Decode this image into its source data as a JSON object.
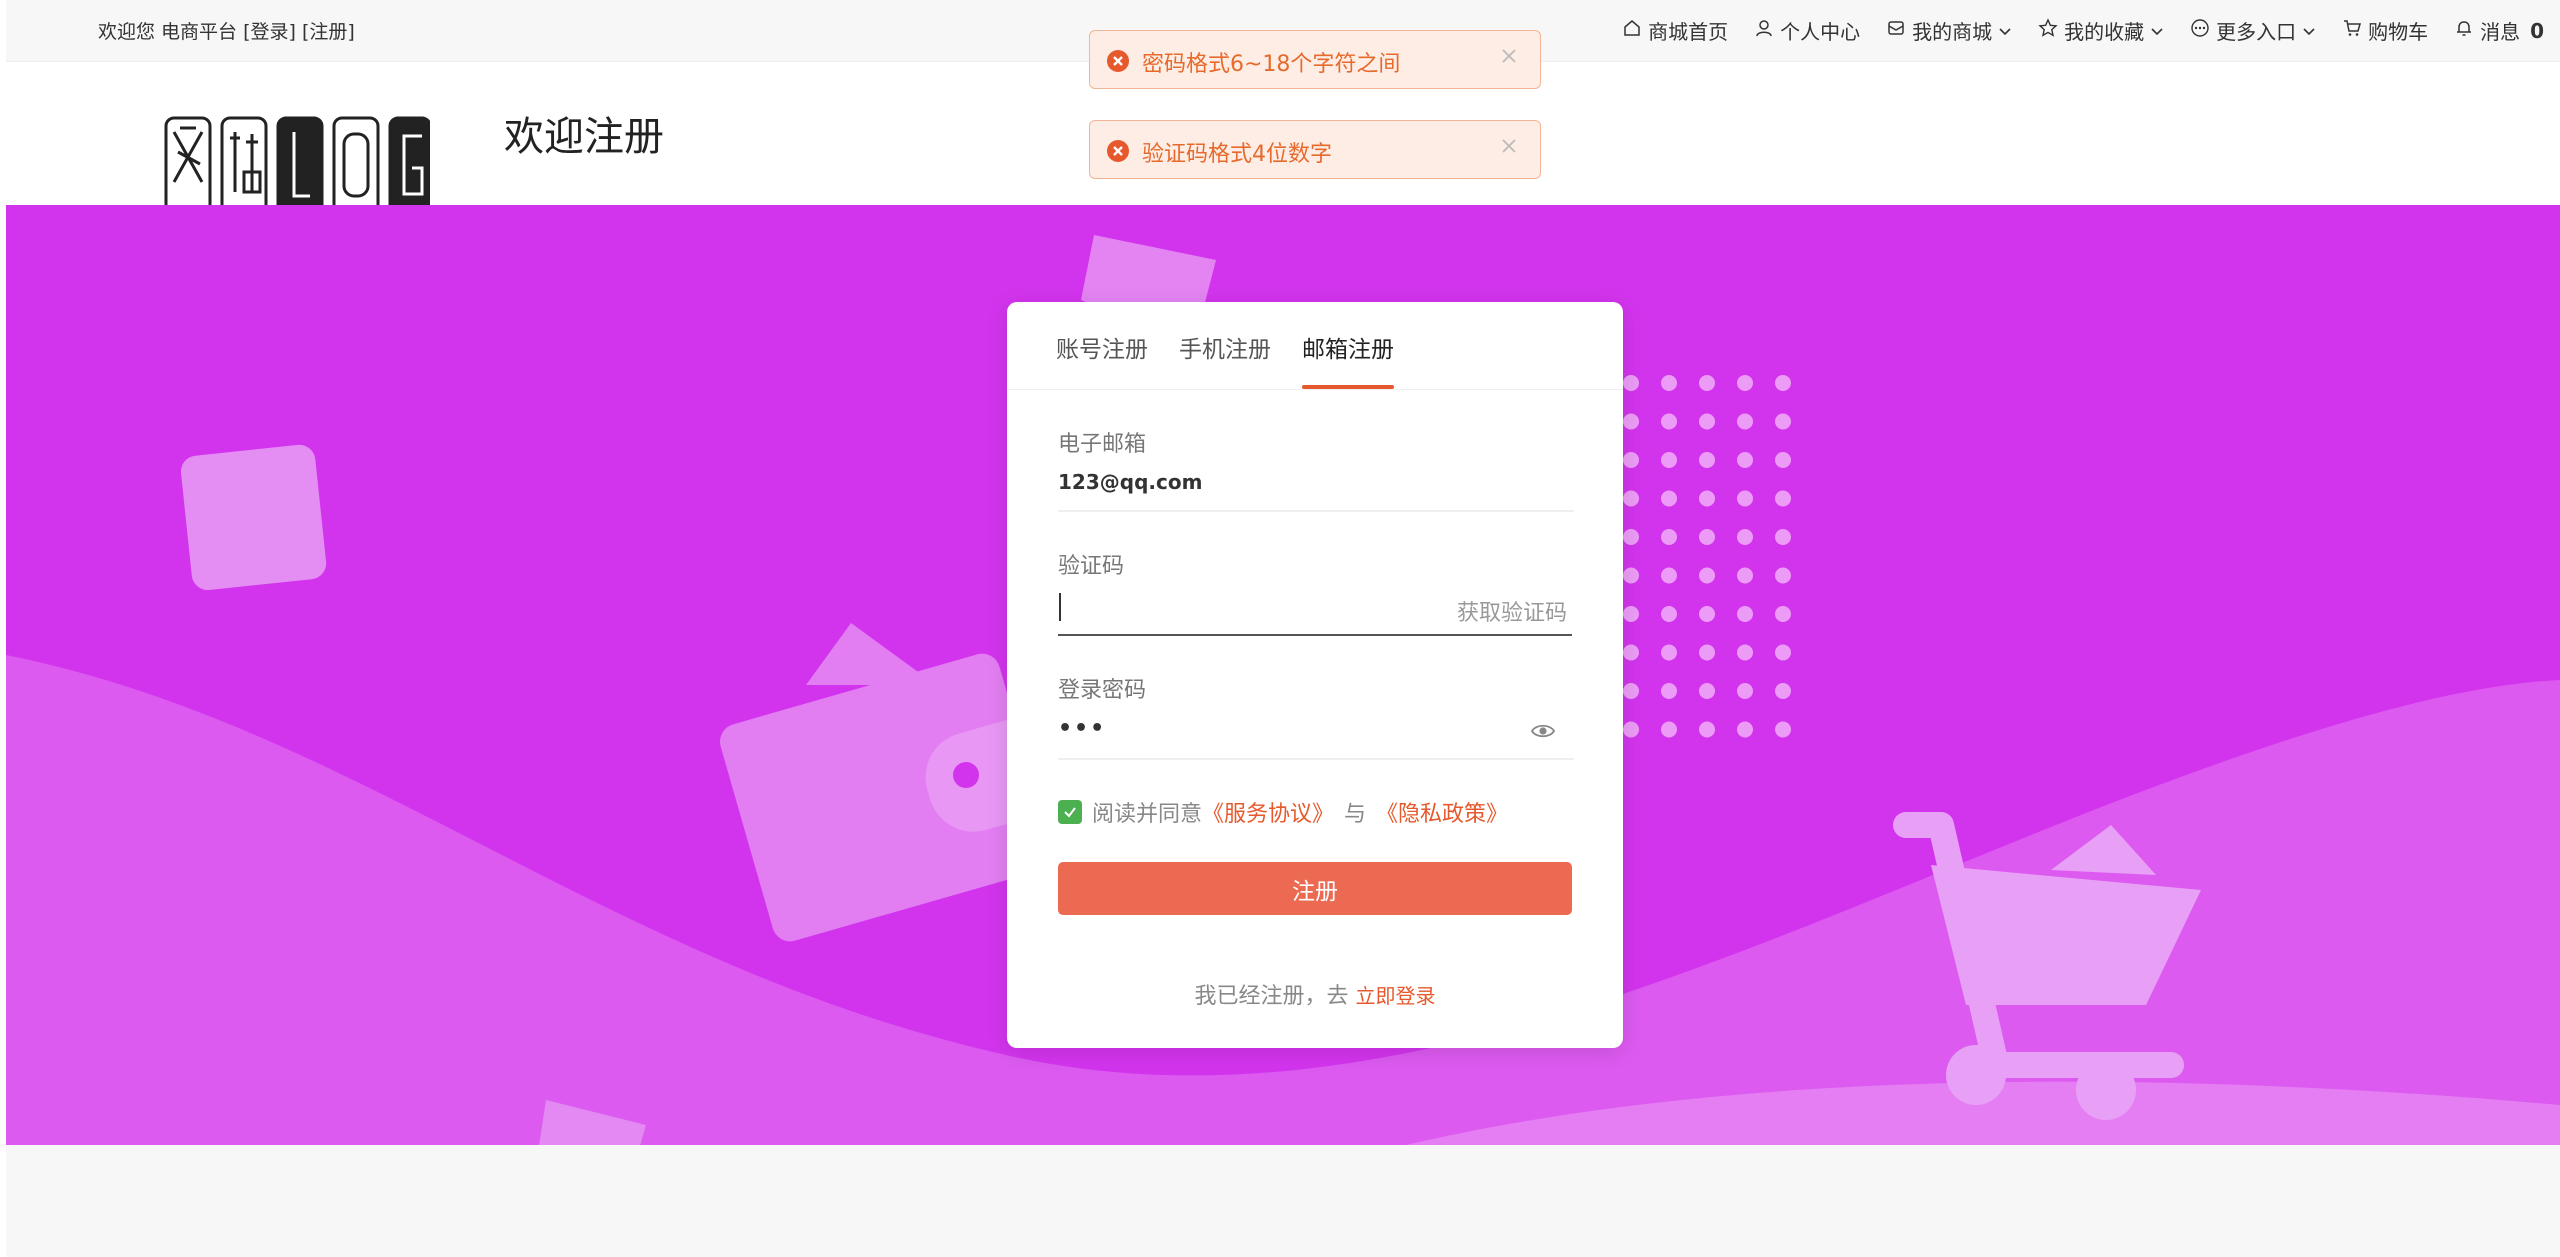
{
  "topbar": {
    "welcome": "欢迎您 电商平台",
    "login_link": "[登录]",
    "register_link": "[注册]",
    "nav": [
      {
        "label": "商城首页",
        "icon": "home-icon"
      },
      {
        "label": "个人中心",
        "icon": "user-icon"
      },
      {
        "label": "我的商城",
        "icon": "mall-icon",
        "dropdown": true
      },
      {
        "label": "我的收藏",
        "icon": "star-icon",
        "dropdown": true
      },
      {
        "label": "更多入口",
        "icon": "more-icon",
        "dropdown": true
      },
      {
        "label": "购物车",
        "icon": "cart-icon"
      },
      {
        "label": "消息",
        "icon": "bell-icon",
        "count": "0"
      }
    ]
  },
  "header": {
    "title": "欢迎注册",
    "logo_text": "网站LOG"
  },
  "toasts": [
    {
      "message": "密码格式6~18个字符之间",
      "type": "error"
    },
    {
      "message": "验证码格式4位数字",
      "type": "error"
    }
  ],
  "form": {
    "tabs": [
      {
        "label": "账号注册",
        "active": false
      },
      {
        "label": "手机注册",
        "active": false
      },
      {
        "label": "邮箱注册",
        "active": true
      }
    ],
    "email_label": "电子邮箱",
    "email_value": "123@qq.com",
    "code_label": "验证码",
    "code_value": "",
    "get_code": "获取验证码",
    "password_label": "登录密码",
    "password_mask": "•••",
    "agree_prefix": "阅读并同意",
    "service_agreement": "《服务协议》",
    "agree_and": "与",
    "privacy_policy": "《隐私政策》",
    "agreed": true,
    "submit": "注册",
    "login_hint": "我已经注册，去",
    "login_now": "立即登录"
  },
  "colors": {
    "banner": "#d234ed",
    "accent": "#e6592c",
    "button": "#eb6a51",
    "toast_bg": "#fdede4",
    "toast_text": "#e76a2d",
    "checkbox": "#4caf50"
  }
}
